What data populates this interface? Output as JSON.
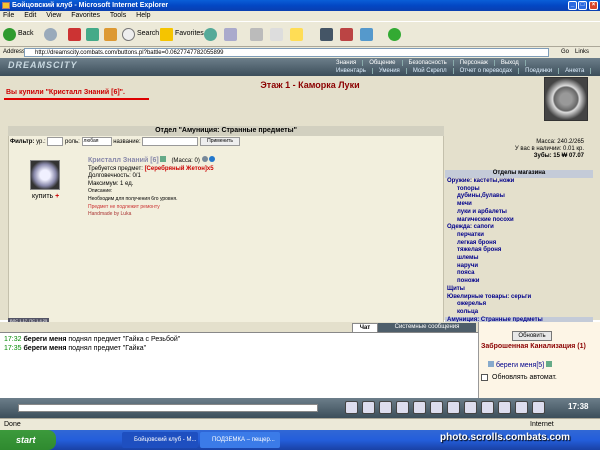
{
  "window": {
    "title": "Бойцовский клуб - Microsoft Internet Explorer"
  },
  "menu": [
    "File",
    "Edit",
    "View",
    "Favorites",
    "Tools",
    "Help"
  ],
  "toolbar": {
    "back": "Back",
    "search": "Search",
    "favorites": "Favorites"
  },
  "address": {
    "label": "Address",
    "url": "http://dreamscity.combats.com/buttons.pl?battle=0.0627747782055899",
    "go": "Go",
    "links": "Links"
  },
  "site": {
    "logo": "DREAMSCITY",
    "nav_top": [
      "Знания",
      "Общение",
      "Безопасность",
      "Персонаж",
      "Выход"
    ],
    "nav_bottom": [
      "Инвентарь",
      "Умения",
      "Мой Скрепл",
      "Отчет о переводах",
      "Поединки",
      "Анкета"
    ]
  },
  "page": {
    "floor_title": "Этаж 1 - Каморка Луки",
    "purchase_msg": "Вы купили \"Кристалл Знаний [6]\"."
  },
  "stats": {
    "mass": "Масса: 240.2/265",
    "money": "У вас в наличии: 0.01 кр.",
    "teeth": "Зубы: 15 ₩ 07.07"
  },
  "shop": {
    "header": "Отдел \"Амуниция: Странные предметы\"",
    "filter_label": "Фильтр:",
    "level_label": "ур.:",
    "role_label": "роль:",
    "role_value": "любая",
    "name_label": "название:",
    "apply_label": "Применить",
    "item": {
      "name": "Кристалл Знаний [6]",
      "mass": "(Масса: 0)",
      "required": "Требуется предмет:",
      "required_item": "[Серебряный Жетон]x5",
      "durability": "Долговечность: 0/1",
      "max": "Максимум: 1 ед.",
      "desc_label": "Описание:",
      "desc": "Необходим для получения 6го уровня.",
      "no_repair": "Предмет не подлежит ремонту",
      "handmade": "Handmade by Luka",
      "buy": "купить"
    }
  },
  "categories": {
    "header": "Отделы магазина",
    "items": [
      {
        "label": "Оружие: кастеты,ножи",
        "level": "main"
      },
      {
        "label": "топоры",
        "level": "sub"
      },
      {
        "label": "дубины,булавы",
        "level": "sub"
      },
      {
        "label": "мечи",
        "level": "sub"
      },
      {
        "label": "луки и арбалеты",
        "level": "sub"
      },
      {
        "label": "магические посохи",
        "level": "sub"
      },
      {
        "label": "Одежда: сапоги",
        "level": "main"
      },
      {
        "label": "перчатки",
        "level": "sub"
      },
      {
        "label": "легкая броня",
        "level": "sub"
      },
      {
        "label": "тяжелая броня",
        "level": "sub"
      },
      {
        "label": "шлемы",
        "level": "sub"
      },
      {
        "label": "наручи",
        "level": "sub"
      },
      {
        "label": "пояса",
        "level": "sub"
      },
      {
        "label": "поножи",
        "level": "sub"
      },
      {
        "label": "Щиты",
        "level": "main"
      },
      {
        "label": "Ювелирные товары: серьги",
        "level": "main"
      },
      {
        "label": "ожерелья",
        "level": "sub"
      },
      {
        "label": "кольца",
        "level": "sub"
      },
      {
        "label": "Амуниция: Странные предметы",
        "level": "main-selected"
      }
    ]
  },
  "ticker": "ВЛС 1.17, ПС 1.4.25",
  "chat": {
    "tab_chat": "Чат",
    "tab_system": "Системные сообщения",
    "lines": [
      {
        "time": "17:32",
        "user": "береги меня",
        "text": "поднял предмет \"Гайка с Резьбой\""
      },
      {
        "time": "17:35",
        "user": "береги меня",
        "text": "поднял предмет \"Гайка\""
      }
    ]
  },
  "right": {
    "refresh": "Обновить",
    "location": "Заброшенная Канализация (1)",
    "player": "береги меня[5]",
    "auto": "Обновлять автомат."
  },
  "clock": "17:38",
  "status": {
    "left": "Done",
    "right": "Internet"
  },
  "taskbar": {
    "start": "start",
    "tasks": [
      "Бойцовский клуб - М...",
      "ПОДЗЕМКА – пещер..."
    ]
  },
  "watermark": "photo.scrolls.combats.com"
}
